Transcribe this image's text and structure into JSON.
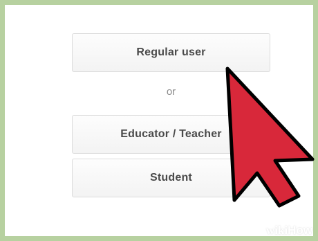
{
  "options": {
    "regular_user": "Regular user",
    "separator": "or",
    "educator": "Educator / Teacher",
    "student": "Student"
  },
  "cursor": {
    "icon": "mouse-pointer-arrow-icon",
    "color": "#d8283a"
  },
  "watermark": {
    "wiki": "wiki",
    "how": "How"
  }
}
